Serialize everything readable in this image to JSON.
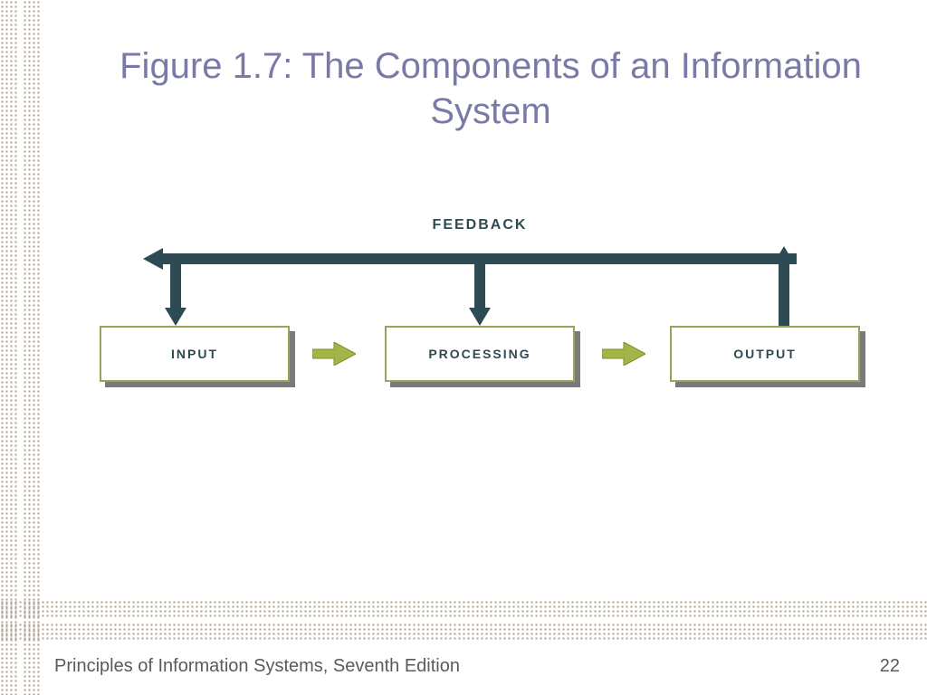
{
  "title": "Figure 1.7: The Components of an Information System",
  "feedback_label": "FEEDBACK",
  "boxes": {
    "input": "INPUT",
    "processing": "PROCESSING",
    "output": "OUTPUT"
  },
  "footer": "Principles of Information Systems, Seventh Edition",
  "page": "22",
  "colors": {
    "title": "#7a7aa8",
    "box_border": "#9fa15b",
    "dark_teal": "#2e4a52",
    "green_arrow": "#a2b547"
  }
}
